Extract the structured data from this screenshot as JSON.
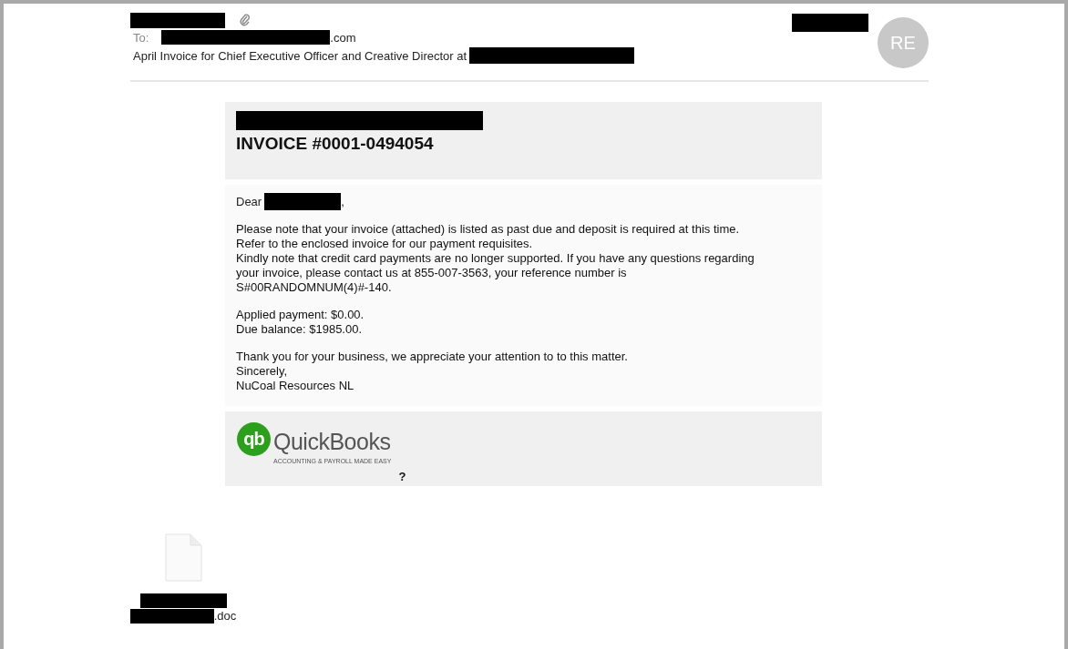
{
  "header": {
    "sender": {
      "redacted": true
    },
    "has_attachment": true,
    "date": {
      "redacted": true
    },
    "avatar": "RE",
    "to_label": "To:",
    "to": {
      "redacted": true,
      "suffix": ".com"
    },
    "subject": {
      "text": "April Invoice for Chief Executive Officer and Creative Director at",
      "redacted_tail": true
    }
  },
  "invoice": {
    "company_redacted": true,
    "title": "INVOICE #0001-0494054",
    "greeting": {
      "text": "Dear",
      "name_redacted": true,
      "punct": ","
    },
    "paragraphs": [
      [
        "Please note that your invoice (attached) is listed as past due and deposit is required at this time.",
        "Refer to the enclosed invoice for our payment requisites.",
        "Kindly note that credit card payments are no longer supported. If you have any questions regarding",
        "your invoice, please contact us at 855-007-3563, your reference number is",
        "S#00RANDOMNUM(4)#-140."
      ],
      [
        "Applied payment: $0.00.",
        "Due balance: $1985.00."
      ],
      [
        "Thank you for your business, we appreciate your attention to to this matter.",
        "Sincerely,",
        "NuCoal Resources NL"
      ]
    ],
    "logo": {
      "mark": "qb",
      "name": "QuickBooks",
      "tagline": "ACCOUNTING & PAYROLL MADE EASY",
      "trailing": "?"
    }
  },
  "attachment": {
    "name_redacted": true,
    "suffix": ".doc"
  }
}
